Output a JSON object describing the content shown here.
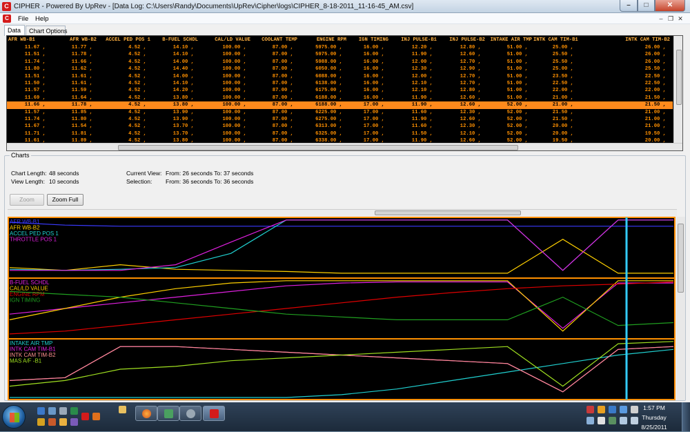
{
  "window": {
    "title": "CIPHER - Powered By UpRev - [Data Log: C:\\Users\\Randy\\Documents\\UpRev\\Cipher\\logs\\CIPHER_8-18-2011_11-16-45_AM.csv]",
    "icon": "C"
  },
  "menu": {
    "file": "File",
    "help": "Help"
  },
  "tabs": [
    {
      "label": "Data"
    },
    {
      "label": "Chart Options"
    }
  ],
  "grid": {
    "columns": [
      "AFR WB-B1",
      "AFR WB-B2",
      "ACCEL PED POS 1",
      "B-FUEL SCHDL",
      "CAL/LD VALUE",
      "COOLANT TEMP",
      "ENGINE RPM",
      "IGN TIMING",
      "INJ PULSE-B1",
      "INJ PULSE-B2",
      "INTAKE AIR TMP",
      "INTK CAM TIM-B1",
      "INTK CAM TIM-B2"
    ],
    "selected_row": 8,
    "rows": [
      [
        "11.67 ,",
        "11.77 ,",
        "4.52 ,",
        "14.10 ,",
        "100.00 ,",
        "87.00 ,",
        "5975.00 ,",
        "16.00 ,",
        "12.20 ,",
        "12.80 ,",
        "51.00 ,",
        "25.00 ,",
        "26.00 ,"
      ],
      [
        "11.51 ,",
        "11.78 ,",
        "4.52 ,",
        "14.10 ,",
        "100.00 ,",
        "87.00 ,",
        "5975.00 ,",
        "16.00 ,",
        "11.90 ,",
        "12.60 ,",
        "51.00 ,",
        "25.50 ,",
        "26.00 ,"
      ],
      [
        "11.74 ,",
        "11.66 ,",
        "4.52 ,",
        "14.00 ,",
        "100.00 ,",
        "87.00 ,",
        "5988.00 ,",
        "16.00 ,",
        "12.00 ,",
        "12.70 ,",
        "51.00 ,",
        "25.50 ,",
        "26.00 ,"
      ],
      [
        "11.80 ,",
        "11.62 ,",
        "4.52 ,",
        "14.40 ,",
        "100.00 ,",
        "87.00 ,",
        "6050.00 ,",
        "16.00 ,",
        "12.30 ,",
        "12.90 ,",
        "51.00 ,",
        "25.00 ,",
        "25.50 ,"
      ],
      [
        "11.51 ,",
        "11.61 ,",
        "4.52 ,",
        "14.00 ,",
        "100.00 ,",
        "87.00 ,",
        "6088.00 ,",
        "16.00 ,",
        "12.00 ,",
        "12.70 ,",
        "51.00 ,",
        "23.50 ,",
        "22.50 ,"
      ],
      [
        "11.50 ,",
        "11.61 ,",
        "4.52 ,",
        "14.10 ,",
        "100.00 ,",
        "87.00 ,",
        "6138.00 ,",
        "16.00 ,",
        "12.10 ,",
        "12.70 ,",
        "51.00 ,",
        "22.50 ,",
        "22.50 ,"
      ],
      [
        "11.57 ,",
        "11.59 ,",
        "4.52 ,",
        "14.20 ,",
        "100.00 ,",
        "87.00 ,",
        "6175.00 ,",
        "16.00 ,",
        "12.10 ,",
        "12.80 ,",
        "51.00 ,",
        "22.00 ,",
        "22.00 ,"
      ],
      [
        "11.69 ,",
        "11.64 ,",
        "4.52 ,",
        "13.80 ,",
        "100.00 ,",
        "87.00 ,",
        "6188.00 ,",
        "16.00 ,",
        "11.90 ,",
        "12.60 ,",
        "51.00 ,",
        "21.00 ,",
        "21.50 ,"
      ],
      [
        "11.66 ,",
        "11.78 ,",
        "4.52 ,",
        "13.80 ,",
        "100.00 ,",
        "87.00 ,",
        "6188.00 ,",
        "17.00 ,",
        "11.90 ,",
        "12.60 ,",
        "52.00 ,",
        "21.00 ,",
        "21.50 ,"
      ],
      [
        "11.57 ,",
        "11.85 ,",
        "4.52 ,",
        "13.90 ,",
        "100.00 ,",
        "87.00 ,",
        "6225.00 ,",
        "17.00 ,",
        "11.60 ,",
        "12.30 ,",
        "52.00 ,",
        "21.50 ,",
        "21.00 ,"
      ],
      [
        "11.74 ,",
        "11.80 ,",
        "4.52 ,",
        "13.90 ,",
        "100.00 ,",
        "87.00 ,",
        "6275.00 ,",
        "17.00 ,",
        "11.90 ,",
        "12.60 ,",
        "52.00 ,",
        "21.50 ,",
        "21.00 ,"
      ],
      [
        "11.67 ,",
        "11.54 ,",
        "4.52 ,",
        "13.70 ,",
        "100.00 ,",
        "87.00 ,",
        "6313.00 ,",
        "17.00 ,",
        "11.60 ,",
        "12.30 ,",
        "52.00 ,",
        "20.00 ,",
        "21.00 ,"
      ],
      [
        "11.71 ,",
        "11.81 ,",
        "4.52 ,",
        "13.70 ,",
        "100.00 ,",
        "87.00 ,",
        "6325.00 ,",
        "17.00 ,",
        "11.50 ,",
        "12.10 ,",
        "52.00 ,",
        "20.00 ,",
        "19.50 ,"
      ],
      [
        "11.61 ,",
        "11.89 ,",
        "4.52 ,",
        "13.80 ,",
        "100.00 ,",
        "87.00 ,",
        "6338.00 ,",
        "17.00 ,",
        "11.90 ,",
        "12.60 ,",
        "52.00 ,",
        "19.50 ,",
        "20.00 ,"
      ]
    ]
  },
  "charts": {
    "group_label": "Charts",
    "chart_length_label": "Chart Length:",
    "chart_length_value": "48 seconds",
    "view_length_label": "View Length:",
    "view_length_value": "10 seconds",
    "current_view_label": "Current View:",
    "current_view_value": "From: 26 seconds To: 37 seconds",
    "selection_label": "Selection:",
    "selection_value": "From: 36 seconds To: 36 seconds",
    "zoom_label": "Zoom",
    "zoom_full_label": "Zoom Full",
    "frame_color": "#ff9000",
    "cursor_color": "#33ccff"
  },
  "chart_data": [
    {
      "type": "line",
      "series": [
        {
          "name": "AFR WB-B1",
          "color": "#3a3aff",
          "values": [
            0.95,
            0.9,
            0.88,
            0.88,
            0.88,
            0.88,
            0.88,
            0.88,
            0.88,
            0.88,
            0.88,
            0.88,
            0.88
          ]
        },
        {
          "name": "AFR WB-B2",
          "color": "#ffd000",
          "values": [
            0.15,
            0.1,
            0.2,
            0.12,
            0.1,
            0.08,
            0.05,
            0.05,
            0.05,
            0.05,
            0.65,
            0.05,
            0.05
          ]
        },
        {
          "name": "ACCEL PED POS 1",
          "color": "#20d0d0",
          "values": [
            0.12,
            0.1,
            0.12,
            0.15,
            0.4,
            0.99,
            0.99,
            0.99,
            0.99,
            0.99,
            0.1,
            0.99,
            0.99
          ]
        },
        {
          "name": "THROTTLE POS 1",
          "color": "#e020e0",
          "values": [
            0.1,
            0.1,
            0.1,
            0.2,
            0.6,
            0.99,
            0.99,
            0.99,
            0.99,
            0.99,
            0.1,
            0.99,
            0.99
          ]
        }
      ]
    },
    {
      "type": "line",
      "series": [
        {
          "name": "B-FUEL SCHDL",
          "color": "#e020e0",
          "values": [
            0.4,
            0.5,
            0.6,
            0.7,
            0.8,
            0.9,
            0.95,
            0.97,
            0.97,
            0.97,
            0.15,
            0.95,
            0.95
          ]
        },
        {
          "name": "CAL/LD VALUE",
          "color": "#ffd000",
          "values": [
            0.3,
            0.5,
            0.7,
            0.85,
            0.95,
            0.99,
            0.99,
            0.99,
            0.99,
            0.99,
            0.1,
            0.99,
            0.99
          ]
        },
        {
          "name": "ENGINE RPM",
          "color": "#e00000",
          "values": [
            0.05,
            0.1,
            0.2,
            0.3,
            0.4,
            0.5,
            0.6,
            0.7,
            0.78,
            0.85,
            0.9,
            0.93,
            0.97
          ]
        },
        {
          "name": "IGN TIMING",
          "color": "#20a020",
          "values": [
            0.8,
            0.75,
            0.7,
            0.6,
            0.5,
            0.4,
            0.35,
            0.3,
            0.3,
            0.3,
            0.7,
            0.2,
            0.25
          ]
        }
      ]
    },
    {
      "type": "line",
      "series": [
        {
          "name": "INTAKE AIR TMP",
          "color": "#20d0d0",
          "values": [
            0.0,
            0.0,
            0.0,
            0.0,
            0.0,
            0.0,
            0.05,
            0.15,
            0.3,
            0.45,
            0.6,
            0.75,
            0.85
          ]
        },
        {
          "name": "INTK CAM TIM-B1",
          "color": "#e020e0",
          "values": [
            0.3,
            0.35,
            0.9,
            0.9,
            0.85,
            0.8,
            0.75,
            0.7,
            0.65,
            0.6,
            0.1,
            0.85,
            0.9
          ]
        },
        {
          "name": "INTK CAM TIM-B2",
          "color": "#ff9090",
          "values": [
            0.3,
            0.35,
            0.9,
            0.9,
            0.85,
            0.8,
            0.75,
            0.7,
            0.65,
            0.6,
            0.1,
            0.85,
            0.9
          ]
        },
        {
          "name": "MAS A/F -B1",
          "color": "#a0e020",
          "values": [
            0.2,
            0.3,
            0.5,
            0.55,
            0.65,
            0.7,
            0.75,
            0.8,
            0.85,
            0.9,
            0.2,
            0.95,
            0.99
          ]
        }
      ]
    }
  ],
  "taskbar": {
    "clock_time": "1:57 PM",
    "clock_day": "Thursday",
    "clock_date": "8/25/2011"
  }
}
